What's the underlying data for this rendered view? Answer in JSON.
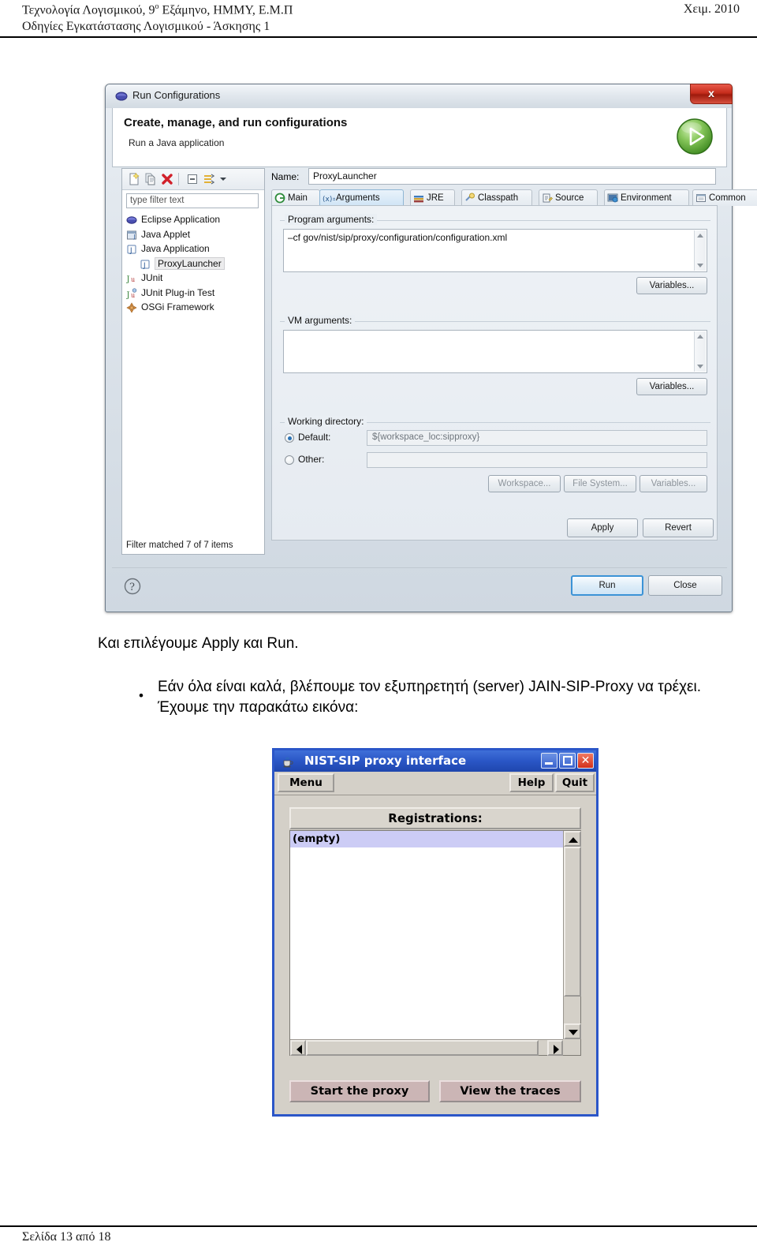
{
  "document": {
    "header": {
      "line1_left_a": "Τεχνολογία Λογισμικού, 9",
      "line1_left_sup": "ο",
      "line1_left_b": " Εξάμηνο, ΗΜΜΥ, Ε.Μ.Π",
      "line1_right": "Χειμ. 2010",
      "line2_left": "Οδηγίες Εγκατάστασης Λογισμικού - Άσκησης 1"
    },
    "footer": {
      "page_label": "Σελίδα 13 από 18"
    },
    "paragraphs": {
      "intro": "Και επιλέγουμε Apply και Run.",
      "bullet_marker": "•",
      "bullet": "Εάν όλα είναι καλά, βλέπουμε τον εξυπηρετητή (server) JAIN-SIP-Proxy να τρέχει. Έχουμε την παρακάτω εικόνα:"
    }
  },
  "run_configurations_dialog": {
    "title": "Run Configurations",
    "title_icon": "eclipse-icon",
    "close_label": "x",
    "banner": {
      "heading": "Create, manage, and run configurations",
      "subheading": "Run a Java application",
      "badge_icon": "run-green-arrow-icon"
    },
    "left_panel": {
      "toolbar": [
        {
          "name": "new-launch-configuration-icon",
          "label": "New launch configuration"
        },
        {
          "name": "duplicate-icon",
          "label": "Duplicate"
        },
        {
          "name": "delete-icon",
          "label": "Delete"
        },
        {
          "name": "collapse-all-icon",
          "label": "Collapse All"
        },
        {
          "name": "filter-icon",
          "label": "Filter launch configurations"
        },
        {
          "name": "view-menu-chevron-down-icon",
          "label": "View Menu"
        }
      ],
      "filter_placeholder": "type filter text",
      "filter_value": "",
      "tree": [
        {
          "label": "Eclipse Application",
          "icon": "eclipse-app-icon",
          "child": false,
          "selected": false
        },
        {
          "label": "Java Applet",
          "icon": "java-applet-icon",
          "child": false,
          "selected": false
        },
        {
          "label": "Java Application",
          "icon": "java-application-icon",
          "child": false,
          "selected": false
        },
        {
          "label": "ProxyLauncher",
          "icon": "java-application-icon",
          "child": true,
          "selected": true
        },
        {
          "label": "JUnit",
          "icon": "junit-icon",
          "child": false,
          "selected": false
        },
        {
          "label": "JUnit Plug-in Test",
          "icon": "junit-plugin-icon",
          "child": false,
          "selected": false
        },
        {
          "label": "OSGi Framework",
          "icon": "osgi-icon",
          "child": false,
          "selected": false
        }
      ],
      "status": "Filter matched 7 of 7 items"
    },
    "name_label": "Name:",
    "name_value": "ProxyLauncher",
    "tabs": [
      {
        "label": "Main",
        "icon": "main-tab-icon",
        "active": false
      },
      {
        "label": "Arguments",
        "icon": "arguments-tab-icon",
        "active": true
      },
      {
        "label": "JRE",
        "icon": "jre-tab-icon",
        "active": false
      },
      {
        "label": "Classpath",
        "icon": "classpath-tab-icon",
        "active": false
      },
      {
        "label": "Source",
        "icon": "source-tab-icon",
        "active": false
      },
      {
        "label": "Environment",
        "icon": "environment-tab-icon",
        "active": false
      },
      {
        "label": "Common",
        "icon": "common-tab-icon",
        "active": false
      }
    ],
    "program_arguments": {
      "group_label": "Program arguments:",
      "value": "–cf gov/nist/sip/proxy/configuration/configuration.xml",
      "variables_button": "Variables..."
    },
    "vm_arguments": {
      "group_label": "VM arguments:",
      "value": "",
      "variables_button": "Variables..."
    },
    "working_directory": {
      "group_label": "Working directory:",
      "default_label": "Default:",
      "default_selected": true,
      "default_value": "${workspace_loc:sipproxy}",
      "other_label": "Other:",
      "other_selected": false,
      "other_value": "",
      "workspace_button": "Workspace...",
      "filesystem_button": "File System...",
      "variables_button": "Variables..."
    },
    "apply_button": "Apply",
    "revert_button": "Revert",
    "help_icon": "help-question-icon",
    "run_button": "Run",
    "close_button": "Close"
  },
  "nist_window": {
    "title": "NIST-SIP proxy interface",
    "title_icon": "java-coffee-cup-icon",
    "window_controls": [
      {
        "name": "minimize-button",
        "glyph": "_"
      },
      {
        "name": "maximize-button",
        "glyph": "□"
      },
      {
        "name": "close-button",
        "glyph": "✕"
      }
    ],
    "menubar": {
      "menu_button": "Menu",
      "help_button": "Help",
      "quit_button": "Quit"
    },
    "registrations": {
      "header": "Registrations:",
      "items": [
        "(empty)"
      ],
      "selected_index": 0
    },
    "actions": {
      "start_proxy": "Start the proxy",
      "view_traces": "View the traces"
    },
    "colors": {
      "titlebar": "#2a56c6",
      "window_border": "#2b56c8",
      "panel": "#d4d0c8",
      "selection": "#ccccf5",
      "action_button": "#cbb5b5"
    }
  }
}
